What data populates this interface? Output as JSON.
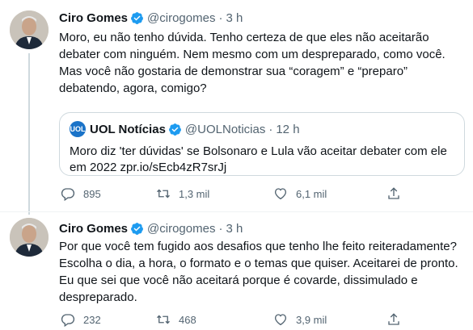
{
  "tweets": [
    {
      "author": "Ciro Gomes",
      "handle": "@cirogomes",
      "time": "3 h",
      "text_lines": [
        "Moro, eu não tenho dúvida. Tenho certeza de que eles não aceitarão",
        "debater com ninguém. Nem mesmo com um despreparado, como você.",
        "Mas você não gostaria de demonstrar sua “coragem” e “preparo”",
        "debatendo, agora, comigo?"
      ],
      "quote": {
        "avatar_text": "UOL",
        "author": "UOL Notícias",
        "handle": "@UOLNoticias",
        "time": "12 h",
        "text_lines": [
          "Moro diz 'ter dúvidas' se Bolsonaro e Lula vão aceitar debater com ele",
          "em 2022 zpr.io/sEcb4zR7srJj"
        ]
      },
      "replies": "895",
      "retweets": "1,3 mil",
      "likes": "6,1 mil"
    },
    {
      "author": "Ciro Gomes",
      "handle": "@cirogomes",
      "time": "3 h",
      "text_lines": [
        "Por que você tem fugido aos desafios que tenho lhe feito reiteradamente?",
        "Escolha o dia, a hora, o formato e o temas que quiser. Aceitarei de pronto.",
        "Eu que sei que você não aceitará porque é covarde, dissimulado e",
        "despreparado."
      ],
      "replies": "232",
      "retweets": "468",
      "likes": "3,9 mil"
    }
  ],
  "colors": {
    "verified": "#1d9bf0",
    "secondary_text": "#536471",
    "border": "#cfd9de"
  },
  "icons": [
    "reply-icon",
    "retweet-icon",
    "like-icon",
    "share-icon",
    "verified-badge-icon"
  ]
}
